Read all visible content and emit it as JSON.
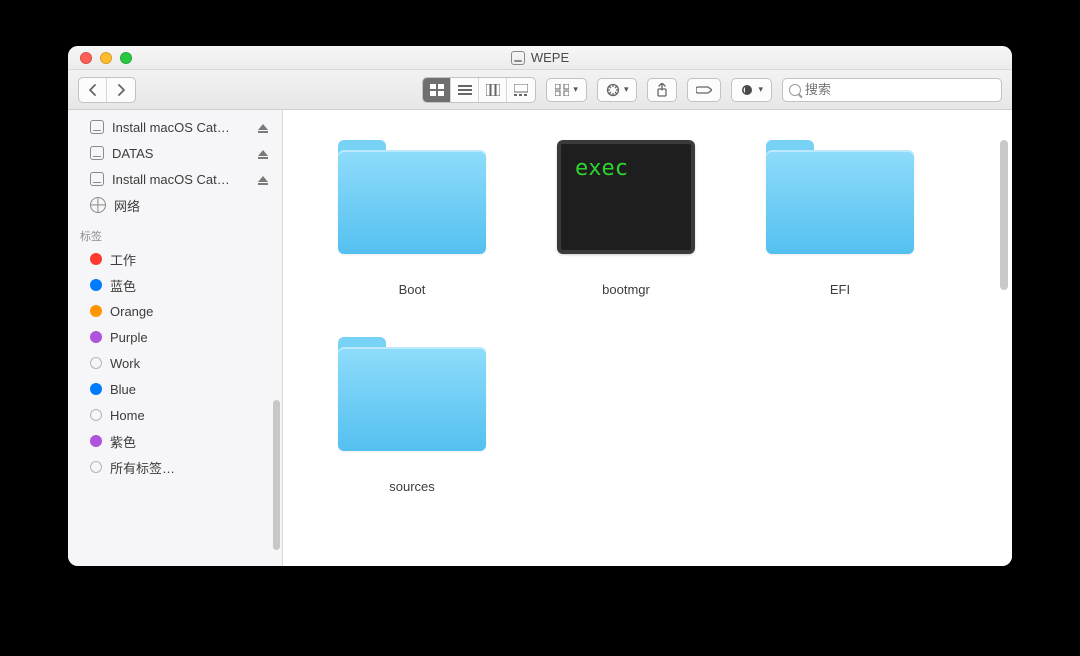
{
  "window": {
    "title": "WEPE"
  },
  "toolbar": {
    "search_placeholder": "搜索"
  },
  "sidebar": {
    "devices": [
      {
        "label": "Install macOS Catalina",
        "ejectable": true
      },
      {
        "label": "DATAS",
        "ejectable": true
      },
      {
        "label": "Install macOS Catalina",
        "ejectable": true
      }
    ],
    "network_label": "网络",
    "tags_header": "标签",
    "tags": [
      {
        "label": "工作",
        "color": "#ff3b30"
      },
      {
        "label": "蓝色",
        "color": "#007aff"
      },
      {
        "label": "Orange",
        "color": "#ff9500"
      },
      {
        "label": "Purple",
        "color": "#af52de"
      },
      {
        "label": "Work",
        "color": "outline"
      },
      {
        "label": "Blue",
        "color": "#007aff"
      },
      {
        "label": "Home",
        "color": "outline"
      },
      {
        "label": "紫色",
        "color": "#af52de"
      },
      {
        "label": "所有标签…",
        "color": "outline"
      }
    ]
  },
  "items": [
    {
      "name": "Boot",
      "kind": "folder"
    },
    {
      "name": "bootmgr",
      "kind": "exec",
      "exec_text": "exec"
    },
    {
      "name": "EFI",
      "kind": "folder"
    },
    {
      "name": "sources",
      "kind": "folder"
    }
  ]
}
